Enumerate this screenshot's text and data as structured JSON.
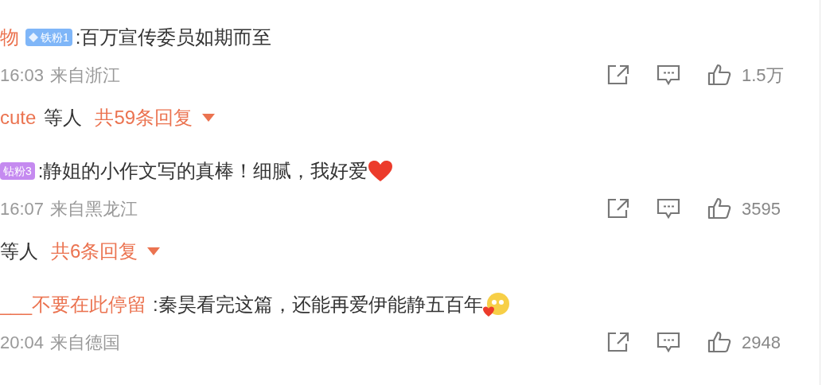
{
  "comments": [
    {
      "name": "物",
      "badge": {
        "label": "铁粉1",
        "color": "#7fb6f8",
        "kind": "icon"
      },
      "text": ":百万宣传委员如期而至",
      "time": "16:03",
      "location": "来自浙江",
      "likes": "1.5万",
      "replies": {
        "names": "cute",
        "suffix": "等人",
        "count": "共59条回复"
      }
    },
    {
      "badge": {
        "label": "钻粉3",
        "color": "#c58af0",
        "kind": "plain"
      },
      "text": ":静姐的小作文写的真棒！细腻，我好爱",
      "emoji": {
        "kind": "heart"
      },
      "time": "16:07",
      "location": "来自黑龙江",
      "likes": "3595",
      "replies": {
        "suffix": "等人",
        "count": "共6条回复"
      }
    },
    {
      "name": "___不要在此停留",
      "text": ":秦昊看完这篇，还能再爱伊能静五百年",
      "emoji": {
        "kind": "blush"
      },
      "time": "20:04",
      "location": "来自德国",
      "likes": "2948"
    }
  ]
}
